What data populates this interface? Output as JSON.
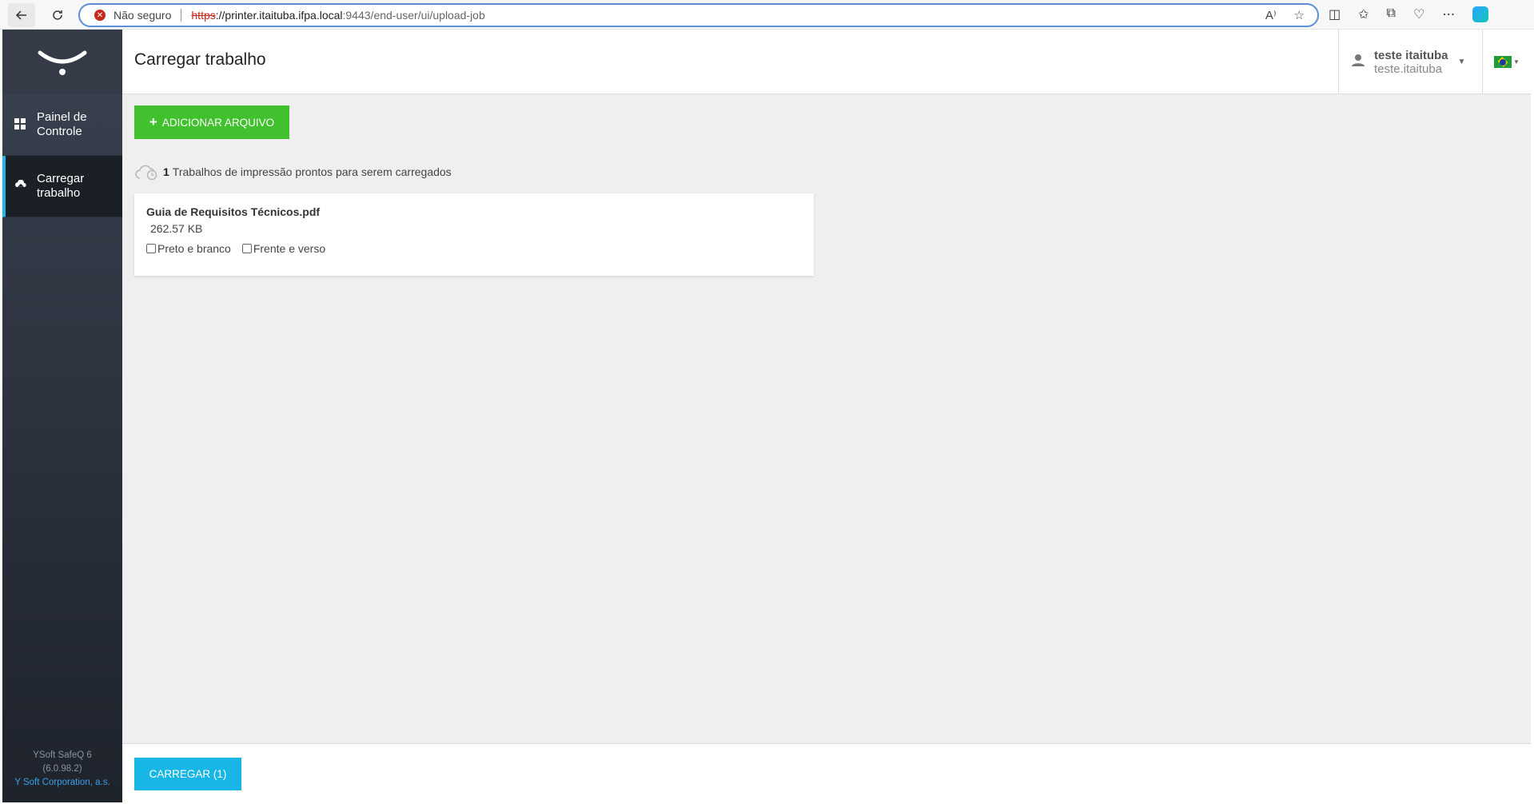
{
  "browser": {
    "security_label": "Não seguro",
    "url_proto": "https",
    "url_host": "://printer.itaituba.ifpa.local",
    "url_rest": ":9443/end-user/ui/upload-job",
    "icons": [
      "back-icon",
      "reload-icon",
      "read-aloud-icon",
      "favorite-star-icon",
      "split-screen-icon",
      "favorites-icon",
      "collections-icon",
      "browser-health-icon",
      "more-icon",
      "copilot-icon"
    ]
  },
  "sidebar": {
    "items": [
      {
        "label": "Painel de Controle",
        "icon": "dashboard-icon"
      },
      {
        "label": "Carregar trabalho",
        "icon": "cloud-upload-icon"
      }
    ],
    "footer_product": "YSoft SafeQ 6",
    "footer_version": "(6.0.98.2)",
    "footer_company": "Y Soft Corporation, a.s."
  },
  "header": {
    "title": "Carregar trabalho",
    "user_name": "teste itaituba",
    "user_login": "teste.itaituba",
    "language_flag": "brazil-flag-icon"
  },
  "main": {
    "add_file_label": "ADICIONAR ARQUIVO",
    "ready_count": "1",
    "ready_text": "Trabalhos de impressão prontos para serem carregados",
    "jobs": [
      {
        "name": "Guia de Requisitos Técnicos.pdf",
        "size": "262.57 KB",
        "option_bw": "Preto e branco",
        "option_duplex": "Frente e verso"
      }
    ],
    "upload_label": "CARREGAR (1)"
  },
  "colors": {
    "add_button": "#41c12e",
    "upload_button": "#17b6e6",
    "active_indicator": "#1fb6e8",
    "sidebar": "#2a303a"
  }
}
